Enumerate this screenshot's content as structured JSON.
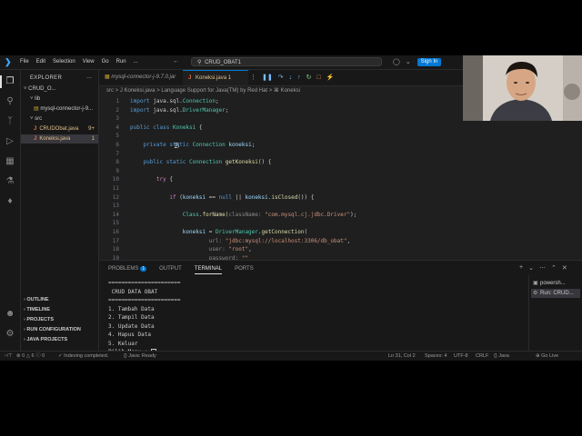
{
  "titlebar": {
    "menu": [
      "File",
      "Edit",
      "Selection",
      "View",
      "Go",
      "Run"
    ],
    "more": "...",
    "search": "CRUD_OBAT1",
    "signin": "Sign In"
  },
  "explorer": {
    "title": "EXPLORER",
    "more": "...",
    "tree": [
      {
        "label": "CRUD_O...",
        "indent": 3,
        "prefix": "v",
        "selected": false
      },
      {
        "label": "lib",
        "indent": 10,
        "prefix": "v",
        "selected": false
      },
      {
        "label": "mysql-connector-j-9...",
        "indent": 14,
        "prefix": "[]",
        "selected": false
      },
      {
        "label": "src",
        "indent": 10,
        "prefix": "v",
        "selected": false
      },
      {
        "label": "CRUDObat.java",
        "indent": 14,
        "prefix": "J",
        "badge": "9+",
        "selected": false
      },
      {
        "label": "Koneksi.java",
        "indent": 14,
        "prefix": "J",
        "badge": "1",
        "selected": true
      }
    ],
    "sections": [
      "OUTLINE",
      "TIMELINE",
      "PROJECTS",
      "RUN CONFIGURATION",
      "JAVA PROJECTS"
    ]
  },
  "editor": {
    "tabs": [
      {
        "label": "mysql-connector-j-9.7.0.jar",
        "active": false
      },
      {
        "label": "Koneksi.java 1",
        "active": true
      }
    ],
    "breadcrumb": "src  >  J  Koneksi.java  >  Language Support for Java(TM) by Red Hat  >  ⌘ Koneksi",
    "lines": [
      {
        "n": "1",
        "html": "<span class=\"kw\">import</span> java.sql.<span class=\"cls\">Connection</span>;"
      },
      {
        "n": "2",
        "html": "<span class=\"kw\">import</span> java.sql.<span class=\"cls\">DriverManager</span>;"
      },
      {
        "n": "3",
        "html": ""
      },
      {
        "n": "4",
        "html": "<span class=\"kw\">public class</span> <span class=\"cls\">Koneksi</span> {"
      },
      {
        "n": "5",
        "html": ""
      },
      {
        "n": "6",
        "html": "    <span class=\"kw\">private static</span> <span class=\"cls\">Connection</span> <span class=\"var\">koneksi</span>;"
      },
      {
        "n": "7",
        "html": ""
      },
      {
        "n": "8",
        "html": "    <span class=\"kw\">public static</span> <span class=\"cls\">Connection</span> <span class=\"fn\">getKoneksi</span>() {"
      },
      {
        "n": "9",
        "html": ""
      },
      {
        "n": "10",
        "html": "        <span class=\"ctrl\">try</span> {"
      },
      {
        "n": "11",
        "html": ""
      },
      {
        "n": "12",
        "html": "            <span class=\"ctrl\">if</span> (<span class=\"var\">koneksi</span> == <span class=\"kw\">null</span> || <span class=\"var\">koneksi</span>.<span class=\"fn\">isClosed</span>()) {"
      },
      {
        "n": "13",
        "html": ""
      },
      {
        "n": "14",
        "html": "                <span class=\"cls\">Class</span>.<span class=\"fn\">forName</span>(<span class=\"hint\">className:</span> <span class=\"str\">\"com.mysql.cj.jdbc.Driver\"</span>);"
      },
      {
        "n": "15",
        "html": ""
      },
      {
        "n": "16",
        "html": "                <span class=\"var\">koneksi</span> = <span class=\"cls\">DriverManager</span>.<span class=\"fn\">getConnection</span>("
      },
      {
        "n": "17",
        "html": "                        <span class=\"hint\">url:</span> <span class=\"str\">\"jdbc:mysql://localhost:3306/db_obat\"</span>,"
      },
      {
        "n": "18",
        "html": "                        <span class=\"hint\">user:</span> <span class=\"str\">\"root\"</span>,"
      },
      {
        "n": "19",
        "html": "                        <span class=\"hint\">password:</span> <span class=\"str\">\"\"</span>"
      }
    ]
  },
  "panel": {
    "tabs": [
      {
        "label": "PROBLEMS",
        "badge": "1",
        "active": false
      },
      {
        "label": "OUTPUT",
        "active": false
      },
      {
        "label": "TERMINAL",
        "active": true
      },
      {
        "label": "PORTS",
        "active": false
      }
    ],
    "terminal_lines": [
      "======================",
      " CRUD DATA OBAT",
      "======================",
      "1. Tambah Data",
      "2. Tampil Data",
      "3. Update Data",
      "4. Hapus Data",
      "5. Keluar",
      "Pilih Menu : "
    ],
    "terminal_list": [
      {
        "label": "powersh...",
        "active": false
      },
      {
        "label": "Run: CRUD...",
        "active": true
      }
    ]
  },
  "statusbar": {
    "errors": "0",
    "warnings": "6",
    "info": "0",
    "indexing": "Indexing completed.",
    "java": "Java: Ready",
    "position": "Ln 31, Col 2",
    "spaces": "Spaces: 4",
    "encoding": "UTF-8",
    "eol": "CRLF",
    "language": "Java",
    "golive": "Go Live"
  },
  "colors": {
    "accent": "#0078d4",
    "editor_bg": "#1f1f1f",
    "sidebar_bg": "#181818"
  }
}
